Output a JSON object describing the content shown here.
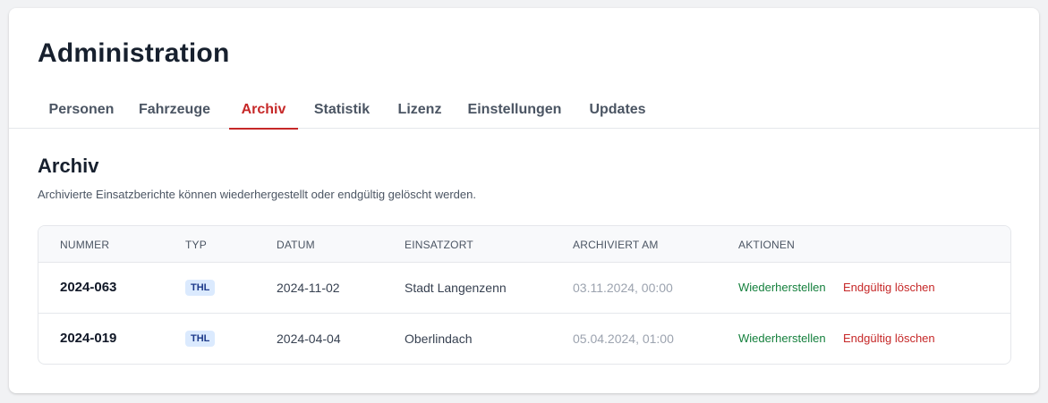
{
  "page": {
    "title": "Administration"
  },
  "tabs": [
    {
      "label": "Personen",
      "active": false
    },
    {
      "label": "Fahrzeuge",
      "active": false
    },
    {
      "label": "Archiv",
      "active": true
    },
    {
      "label": "Statistik",
      "active": false
    },
    {
      "label": "Lizenz",
      "active": false
    },
    {
      "label": "Einstellungen",
      "active": false
    },
    {
      "label": "Updates",
      "active": false
    }
  ],
  "archive": {
    "title": "Archiv",
    "description": "Archivierte Einsatzberichte können wiederhergestellt oder endgültig gelöscht werden.",
    "columns": [
      "Nummer",
      "Typ",
      "Datum",
      "Einsatzort",
      "Archiviert am",
      "Aktionen"
    ],
    "rows": [
      {
        "nummer": "2024-063",
        "typ": "THL",
        "datum": "2024-11-02",
        "einsatzort": "Stadt Langenzenn",
        "archiviert_am": "03.11.2024, 00:00",
        "restore_label": "Wiederherstellen",
        "delete_label": "Endgültig löschen"
      },
      {
        "nummer": "2024-019",
        "typ": "THL",
        "datum": "2024-04-04",
        "einsatzort": "Oberlindach",
        "archiviert_am": "05.04.2024, 01:00",
        "restore_label": "Wiederherstellen",
        "delete_label": "Endgültig löschen"
      }
    ]
  },
  "colors": {
    "accent": "#c62828",
    "restore": "#15803d",
    "badge_bg": "#dbeafe",
    "badge_text": "#1e3a8a"
  }
}
